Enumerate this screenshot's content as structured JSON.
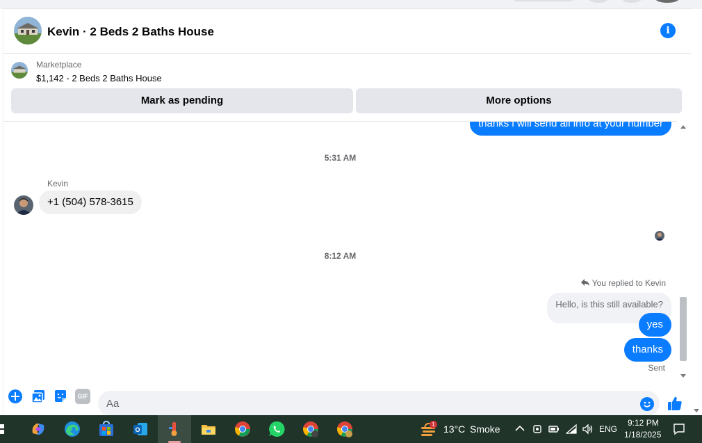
{
  "header": {
    "title": "Kevin · 2 Beds 2 Baths House"
  },
  "listing": {
    "label": "Marketplace",
    "title": "$1,142 - 2 Beds 2 Baths House",
    "mark_pending_label": "Mark as pending",
    "more_options_label": "More options"
  },
  "messages": {
    "top_outgoing": "thanks i will send all info at your number",
    "timestamp_1": "5:31 AM",
    "sender_name": "Kevin",
    "incoming_phone": "+1 (504) 578-3615",
    "timestamp_2": "8:12 AM",
    "reply_label": "You replied to Kevin",
    "quoted_text": "Hello, is this still available?",
    "outgoing_yes": "yes",
    "outgoing_thanks": "thanks",
    "status": "Sent"
  },
  "composer": {
    "placeholder": "Aa",
    "gif_label": "GIF"
  },
  "taskbar": {
    "weather_temp": "13°C",
    "weather_desc": "Smoke",
    "weather_badge": "1",
    "language": "ENG",
    "time": "9:12 PM",
    "date": "1/18/2025"
  },
  "colors": {
    "messenger_blue": "#0a7cff",
    "button_gray": "#e4e6eb",
    "taskbar_bg": "#20342a"
  }
}
